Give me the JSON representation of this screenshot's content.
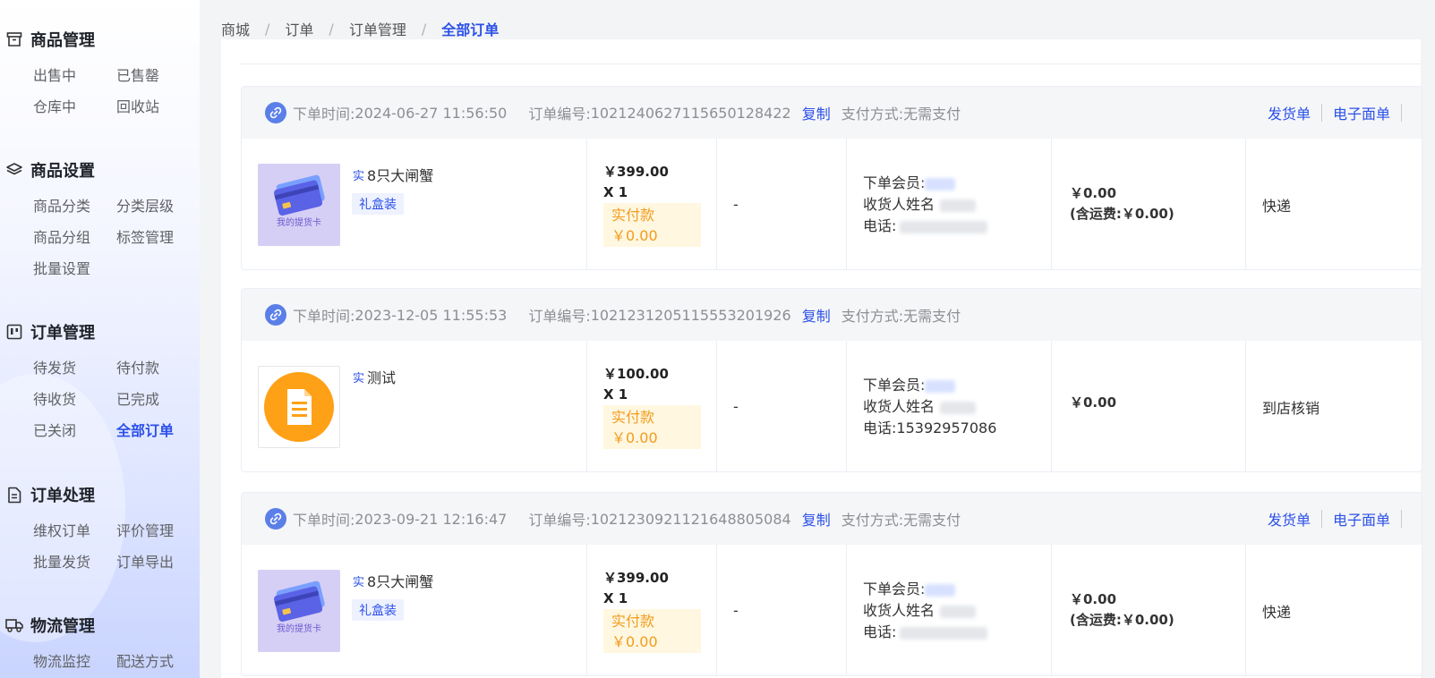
{
  "sidebar": {
    "groups": [
      {
        "title": "商品管理",
        "icon": "archive-box-icon",
        "items": [
          "出售中",
          "已售罄",
          "仓库中",
          "回收站"
        ]
      },
      {
        "title": "商品设置",
        "icon": "layers-icon",
        "items": [
          "商品分类",
          "分类层级",
          "商品分组",
          "标签管理",
          "批量设置"
        ]
      },
      {
        "title": "订单管理",
        "icon": "kanban-icon",
        "items": [
          "待发货",
          "待付款",
          "待收货",
          "已完成",
          "已关闭",
          "全部订单"
        ]
      },
      {
        "title": "订单处理",
        "icon": "document-icon",
        "items": [
          "维权订单",
          "评价管理",
          "批量发货",
          "订单导出"
        ]
      },
      {
        "title": "物流管理",
        "icon": "truck-icon",
        "items": [
          "物流监控",
          "配送方式"
        ]
      }
    ],
    "active_item": "全部订单"
  },
  "breadcrumb": [
    "商城",
    "订单",
    "订单管理",
    "全部订单"
  ],
  "labels": {
    "order_time": "下单时间:",
    "order_no": "订单编号:",
    "copy": "复制",
    "pay_method": "支付方式:",
    "paid": "实付款",
    "member": "下单会员:",
    "receiver": "收货人姓名",
    "phone": "电话:",
    "ship_doc": "发货单",
    "e_label": "电子面单",
    "shi_tag": "实",
    "freight_prefix": "(含运费:",
    "freight_suffix": ")"
  },
  "orders": [
    {
      "time": "2024-06-27 11:56:50",
      "order_no": "102124062711565012842​2",
      "pay": "无需支付",
      "product": "8只大闸蟹",
      "spec": "礼盒装",
      "thumb": "gift-card",
      "thumb_text": "我的提货卡",
      "price": "￥399.00",
      "qty": "X 1",
      "paid_amount": "￥0.00",
      "dash": "-",
      "phone": "",
      "amount": "￥0.00",
      "freight": "￥0.00",
      "delivery": "快递",
      "has_actions": true
    },
    {
      "time": "2023-12-05 11:55:53",
      "order_no": "102123120511555320192​6",
      "pay": "无需支付",
      "product": "测试",
      "spec": "",
      "thumb": "document",
      "thumb_text": "",
      "price": "￥100.00",
      "qty": "X 1",
      "paid_amount": "￥0.00",
      "dash": "-",
      "phone": "15392957086",
      "amount": "￥0.00",
      "freight": "",
      "delivery": "到店核销",
      "has_actions": false
    },
    {
      "time": "2023-09-21 12:16:47",
      "order_no": "102123092112164880508​4",
      "pay": "无需支付",
      "product": "8只大闸蟹",
      "spec": "礼盒装",
      "thumb": "gift-card",
      "thumb_text": "我的提货卡",
      "price": "￥399.00",
      "qty": "X 1",
      "paid_amount": "￥0.00",
      "dash": "-",
      "phone": "",
      "amount": "￥0.00",
      "freight": "￥0.00",
      "delivery": "快递",
      "has_actions": true
    }
  ],
  "colors": {
    "accent": "#2b50e8",
    "paid_bg": "#fff7e0",
    "paid_text": "#f29c1f",
    "header_bg": "#f5f6f8"
  }
}
